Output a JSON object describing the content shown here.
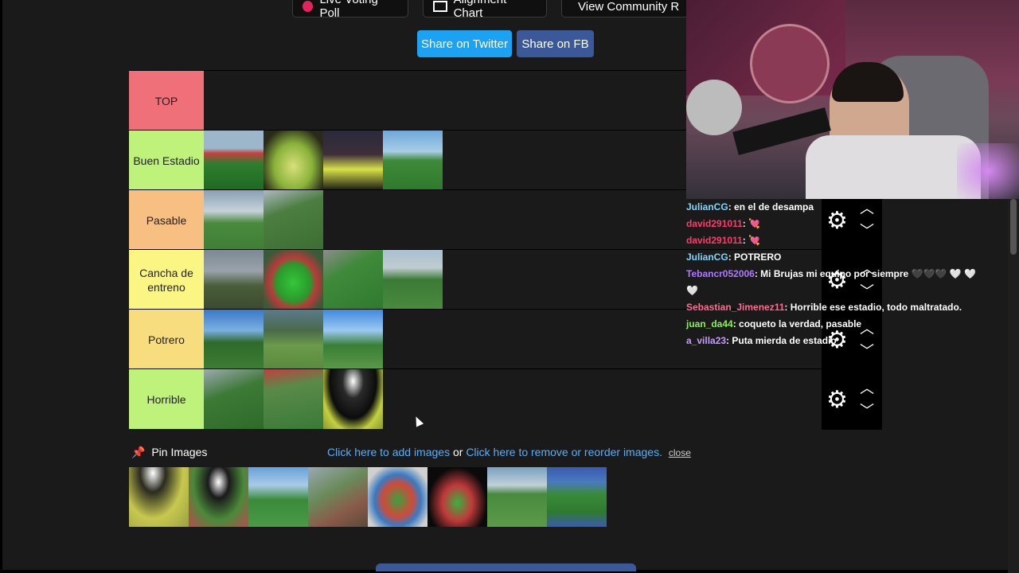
{
  "top_buttons": [
    {
      "label": "Live Voting Poll"
    },
    {
      "label": "Alignment Chart"
    },
    {
      "label": "View Community R"
    }
  ],
  "share": {
    "twitter": "Share on Twitter",
    "fb": "Share on FB"
  },
  "tiers": [
    {
      "label": "TOP",
      "color": "#ef7078",
      "count": 0
    },
    {
      "label": "Buen Estadio",
      "color": "#bff27a",
      "count": 4
    },
    {
      "label": "Pasable",
      "color": "#f8bf82",
      "count": 2
    },
    {
      "label": "Cancha de entreno",
      "color": "#fbf584",
      "count": 4
    },
    {
      "label": "Potrero",
      "color": "#f8dd7e",
      "count": 3
    },
    {
      "label": "Horrible",
      "color": "#bff27a",
      "count": 3
    }
  ],
  "chat": [
    {
      "user": "JulianCG",
      "msg": ": en el de desampa",
      "color": "#7fd6ff"
    },
    {
      "user": "david291011",
      "msg": ": 💘",
      "color": "#ff3b6b"
    },
    {
      "user": "david291011",
      "msg": ": 💘",
      "color": "#ff3b6b"
    },
    {
      "user": "JulianCG",
      "msg": ": POTRERO",
      "color": "#7fd6ff"
    },
    {
      "user": "Tebancr052006",
      "msg": ": Mi Brujas mi equipo por siempre 🖤🖤🖤 🤍 🤍 🤍",
      "color": "#b07aff"
    },
    {
      "user": "Sebastian_Jimenez11",
      "msg": ": Horrible ese estadio, todo maltratado.",
      "color": "#ff6f91"
    },
    {
      "user": "juan_da44",
      "msg": ": coqueto la verdad, pasable",
      "color": "#8cf04f"
    },
    {
      "user": "a_villa23",
      "msg": ": Puta mierda de estadio",
      "color": "#c79bff"
    }
  ],
  "pin": {
    "title": "Pin Images",
    "add_link": "Click here to add images",
    "or": "or",
    "remove_link": "Click here to remove or reorder images.",
    "close": "close"
  },
  "pool_count": 8,
  "icons": {
    "gear": "gear-icon",
    "up": "chevron-up-icon",
    "down": "chevron-down-icon",
    "pin": "pushpin-icon"
  }
}
